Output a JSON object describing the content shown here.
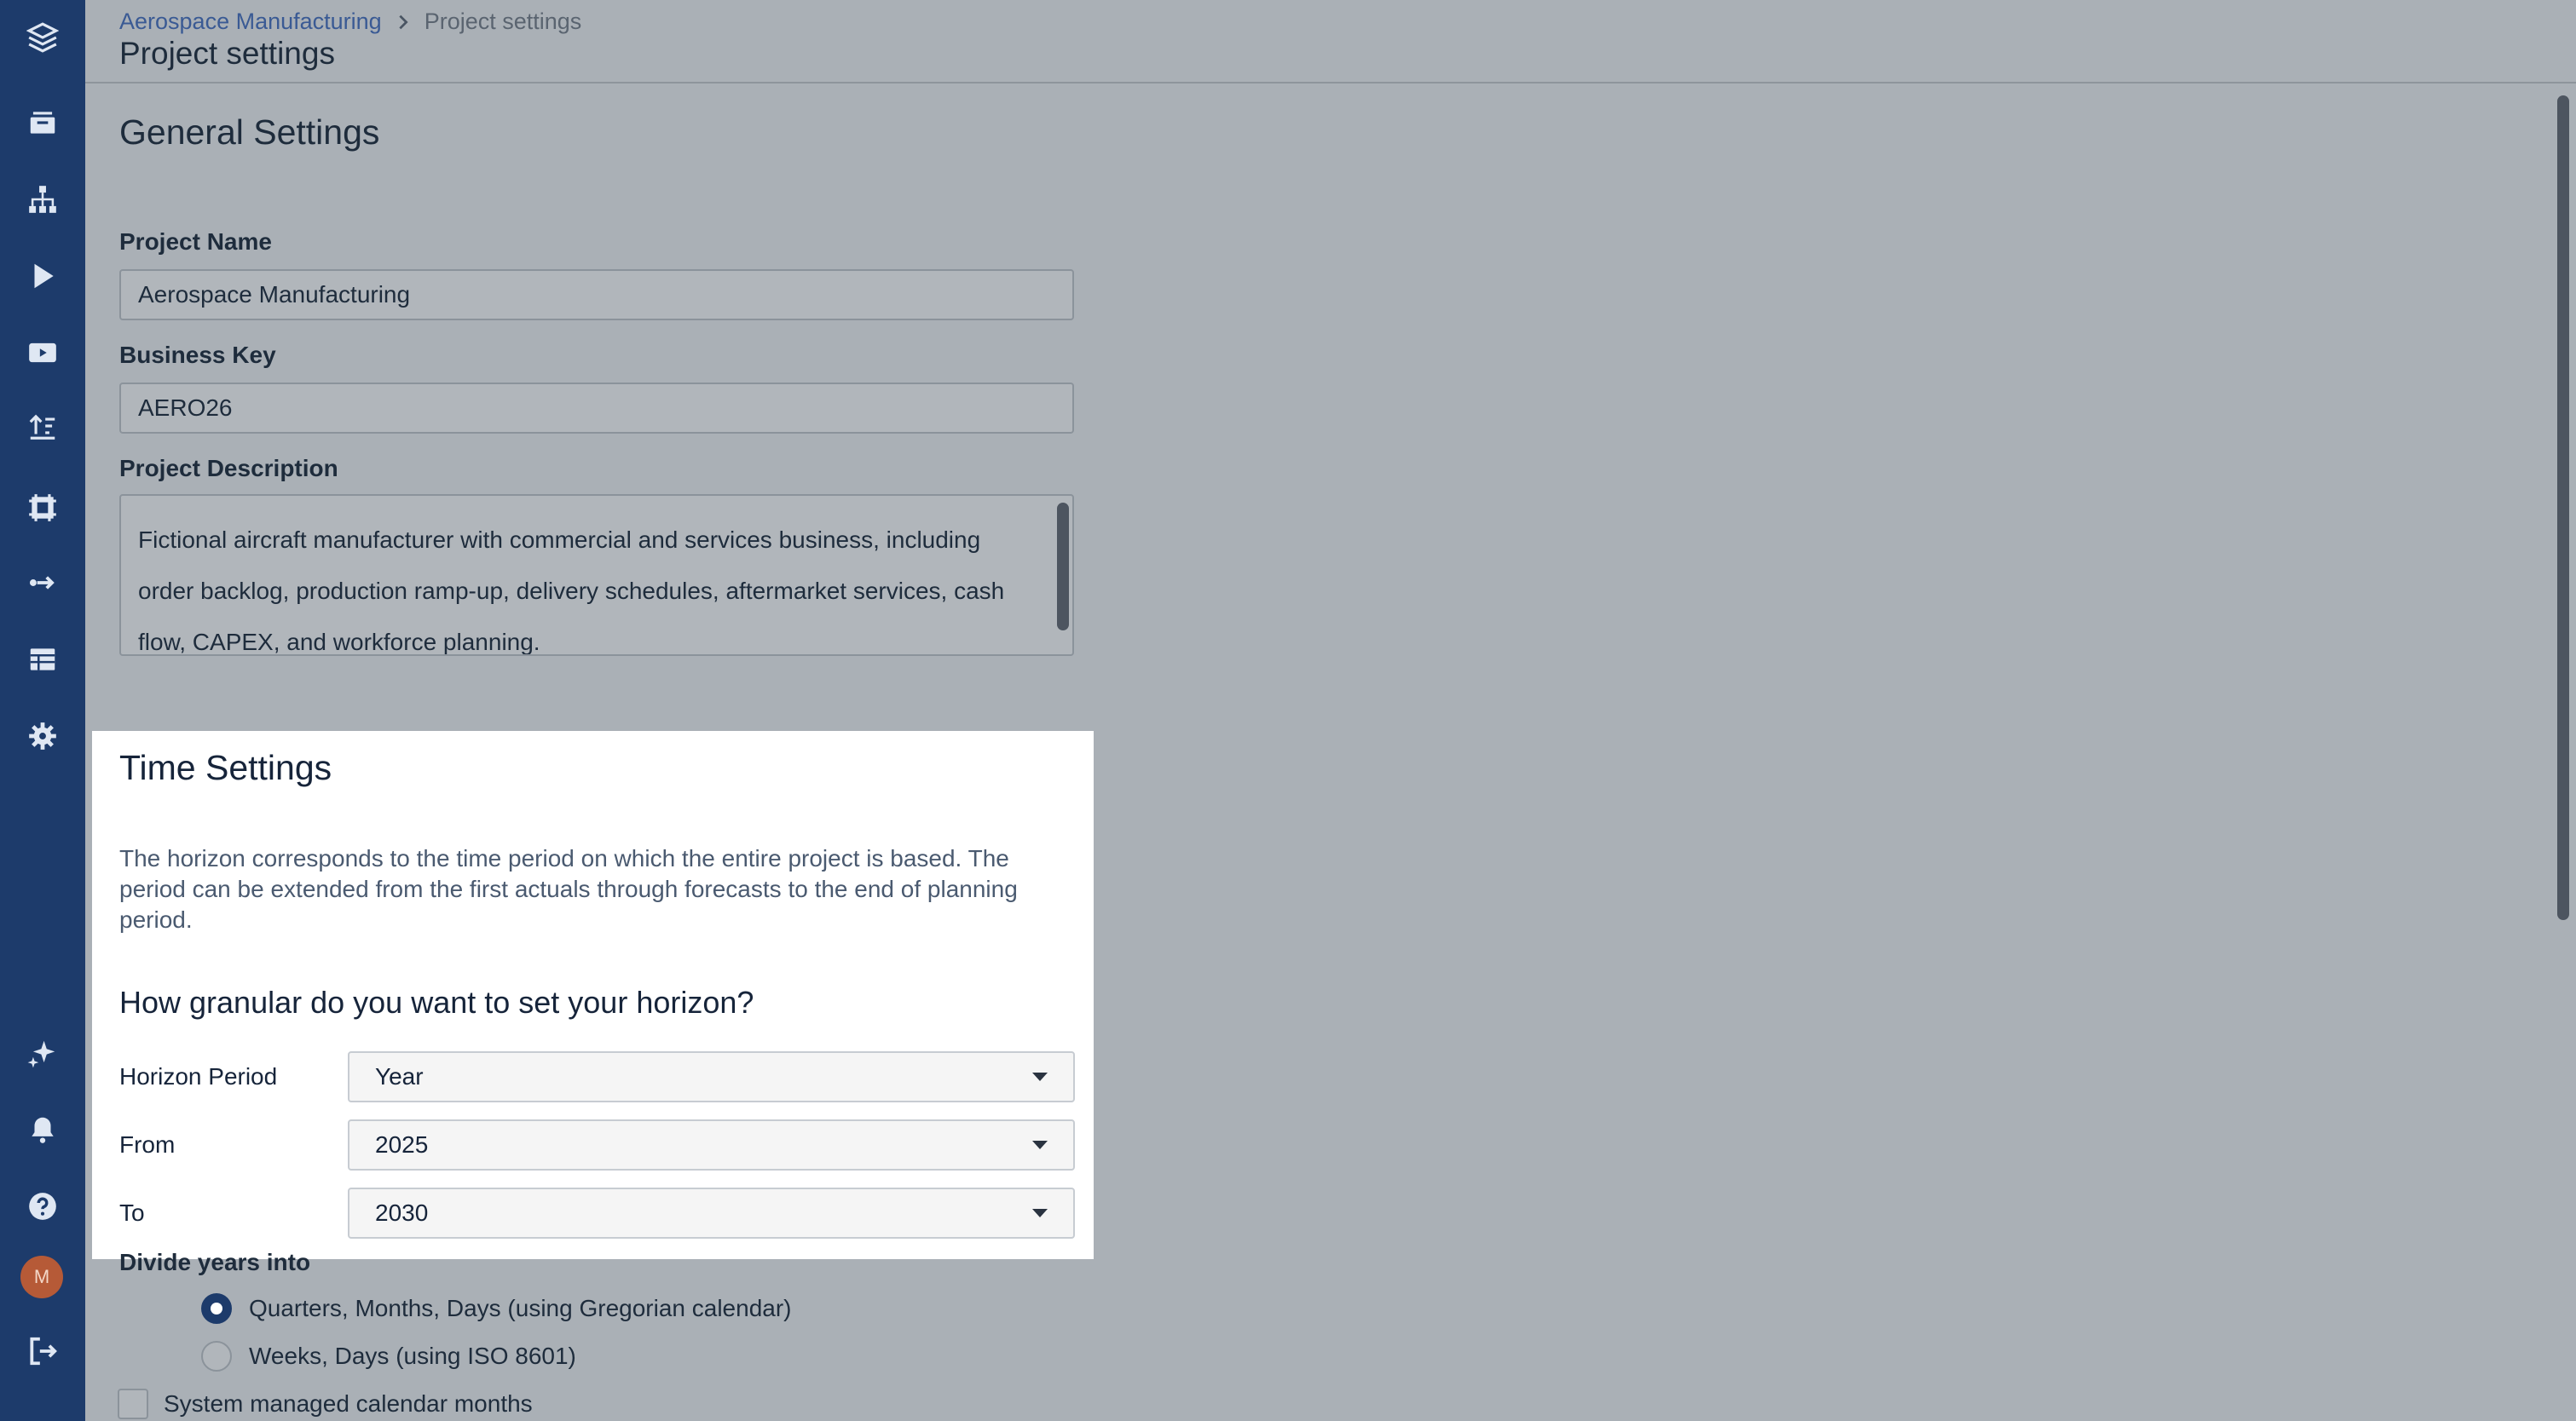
{
  "breadcrumb": {
    "project": "Aerospace Manufacturing",
    "current": "Project settings"
  },
  "page_title": "Project settings",
  "general": {
    "heading": "General Settings",
    "project_name_label": "Project Name",
    "project_name_value": "Aerospace Manufacturing",
    "business_key_label": "Business Key",
    "business_key_value": "AERO26",
    "description_label": "Project Description",
    "description_value": "Fictional aircraft manufacturer with commercial and services business, including order backlog, production ramp-up, delivery schedules, aftermarket services, cash flow, CAPEX, and workforce planning."
  },
  "time": {
    "heading": "Time Settings",
    "description": "The horizon corresponds to the time period on which the entire project is based. The period can be extended from the first actuals through forecasts to the end of planning period.",
    "granular_heading": "How granular do you want to set your horizon?",
    "horizon_period_label": "Horizon Period",
    "horizon_period_value": "Year",
    "from_label": "From",
    "from_value": "2025",
    "to_label": "To",
    "to_value": "2030"
  },
  "divide": {
    "label": "Divide years into",
    "options": [
      {
        "label": "Quarters, Months, Days (using Gregorian calendar)",
        "selected": true
      },
      {
        "label": "Weeks, Days (using ISO 8601)",
        "selected": false
      }
    ],
    "system_managed_label": "System managed calendar months",
    "system_managed_checked": false
  },
  "rail": {
    "items": [
      "layers-icon",
      "inbox-icon",
      "hierarchy-icon",
      "play-icon",
      "video-icon",
      "upload-sort-icon",
      "frame-icon",
      "arrow-into-icon",
      "table-icon",
      "gear-icon",
      "sparkle-icon",
      "bell-icon",
      "help-icon",
      "logout-icon"
    ],
    "avatar_initial": "M",
    "avatar_color": "#b65a37"
  },
  "colors": {
    "rail": "#1d3b6b",
    "link": "#3a5a94",
    "overlay": "#aab0b6",
    "panel": "#ffffff"
  }
}
